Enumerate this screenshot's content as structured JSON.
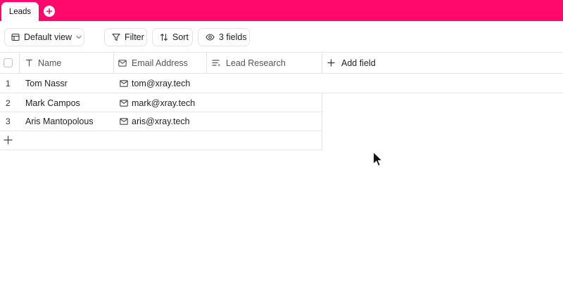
{
  "tabs": [
    {
      "label": "Leads",
      "active": true
    }
  ],
  "toolbar": {
    "view_label": "Default view",
    "filter_label": "Filter",
    "sort_label": "Sort",
    "fields_label": "3 fields"
  },
  "columns": [
    {
      "label": "Name",
      "icon": "text-type-icon"
    },
    {
      "label": "Email Address",
      "icon": "mail-icon"
    },
    {
      "label": "Lead Research",
      "icon": "ai-text-icon"
    }
  ],
  "add_field_label": "Add field",
  "rows": [
    {
      "num": "1",
      "name": "Tom Nassr",
      "email": "tom@xray.tech"
    },
    {
      "num": "2",
      "name": "Mark Campos",
      "email": "mark@xray.tech"
    },
    {
      "num": "3",
      "name": "Aris Mantopolous",
      "email": "aris@xray.tech"
    }
  ],
  "colors": {
    "brand": "#ff0a6c",
    "ai_accent": "#7b5cff"
  }
}
